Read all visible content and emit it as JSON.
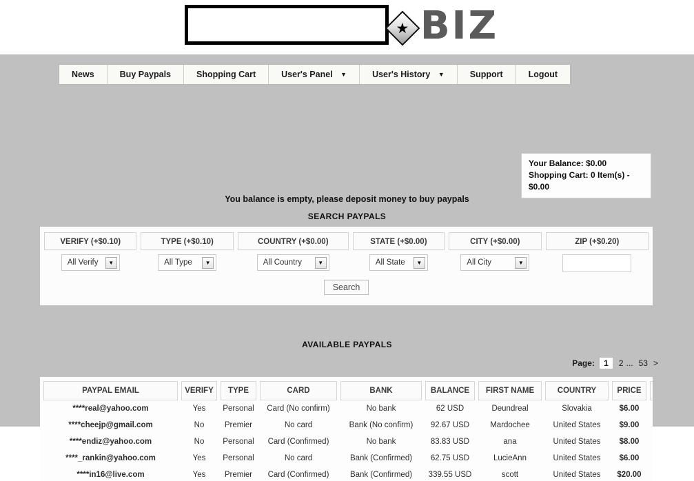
{
  "brand": {
    "logo_text": "BIZ",
    "star_glyph": "★"
  },
  "nav": {
    "items": [
      {
        "label": "News",
        "has_caret": false
      },
      {
        "label": "Buy Paypals",
        "has_caret": false
      },
      {
        "label": "Shopping Cart",
        "has_caret": false
      },
      {
        "label": "User's Panel",
        "has_caret": true
      },
      {
        "label": "User's History",
        "has_caret": true
      },
      {
        "label": "Support",
        "has_caret": false
      },
      {
        "label": "Logout",
        "has_caret": false
      }
    ],
    "caret_glyph": "▼"
  },
  "account": {
    "balance_line": "Your Balance: $0.00",
    "cart_line": "Shopping Cart: 0 Item(s) - $0.00"
  },
  "notice": "You balance is empty, please deposit money to buy paypals",
  "search": {
    "title": "SEARCH PAYPALS",
    "headers": {
      "verify": "VERIFY (+$0.10)",
      "type": "TYPE (+$0.10)",
      "country": "COUNTRY (+$0.00)",
      "state": "STATE (+$0.00)",
      "city": "CITY (+$0.00)",
      "zip": "ZIP (+$0.20)"
    },
    "selects": {
      "verify": "All Verify",
      "type": "All Type",
      "country": "All Country",
      "state": "All State",
      "city": "All City"
    },
    "zip_value": "",
    "zip_placeholder": "",
    "button_label": "Search",
    "select_arrow": "▼"
  },
  "results": {
    "title": "AVAILABLE PAYPALS",
    "pager": {
      "label": "Page:",
      "current": "1",
      "next_page": "2",
      "ellipsis": "...",
      "last_page": "53",
      "next_arrow": ">"
    },
    "columns": [
      "PAYPAL EMAIL",
      "VERIFY",
      "TYPE",
      "CARD",
      "BANK",
      "BALANCE",
      "FIRST NAME",
      "COUNTRY",
      "PRICE"
    ],
    "rows": [
      {
        "email": "****real@yahoo.com",
        "verify": "Yes",
        "type": "Personal",
        "card": "Card (No confirm)",
        "bank": "No bank",
        "balance": "62 USD",
        "first_name": "Deundreal",
        "country": "Slovakia",
        "price": "$6.00"
      },
      {
        "email": "****cheejp@gmail.com",
        "verify": "No",
        "type": "Premier",
        "card": "No card",
        "bank": "Bank (No confirm)",
        "balance": "92.67 USD",
        "first_name": "Mardochee",
        "country": "United States",
        "price": "$9.00"
      },
      {
        "email": "****endiz@yahoo.com",
        "verify": "No",
        "type": "Personal",
        "card": "Card (Confirmed)",
        "bank": "No bank",
        "balance": "83.83 USD",
        "first_name": "ana",
        "country": "United States",
        "price": "$8.00"
      },
      {
        "email": "****_rankin@yahoo.com",
        "verify": "Yes",
        "type": "Personal",
        "card": "No card",
        "bank": "Bank (Confirmed)",
        "balance": "62.75 USD",
        "first_name": "LucieAnn",
        "country": "United States",
        "price": "$6.00"
      },
      {
        "email": "****in16@live.com",
        "verify": "Yes",
        "type": "Premier",
        "card": "Card (Confirmed)",
        "bank": "Bank (Confirmed)",
        "balance": "339.55 USD",
        "first_name": "scott",
        "country": "United States",
        "price": "$20.00"
      }
    ]
  },
  "colors": {
    "page_background": "#c0c0c0",
    "panel_background": "#fcfcfc",
    "nav_background": "#f9f9f6",
    "border": "#d3d3d3"
  }
}
